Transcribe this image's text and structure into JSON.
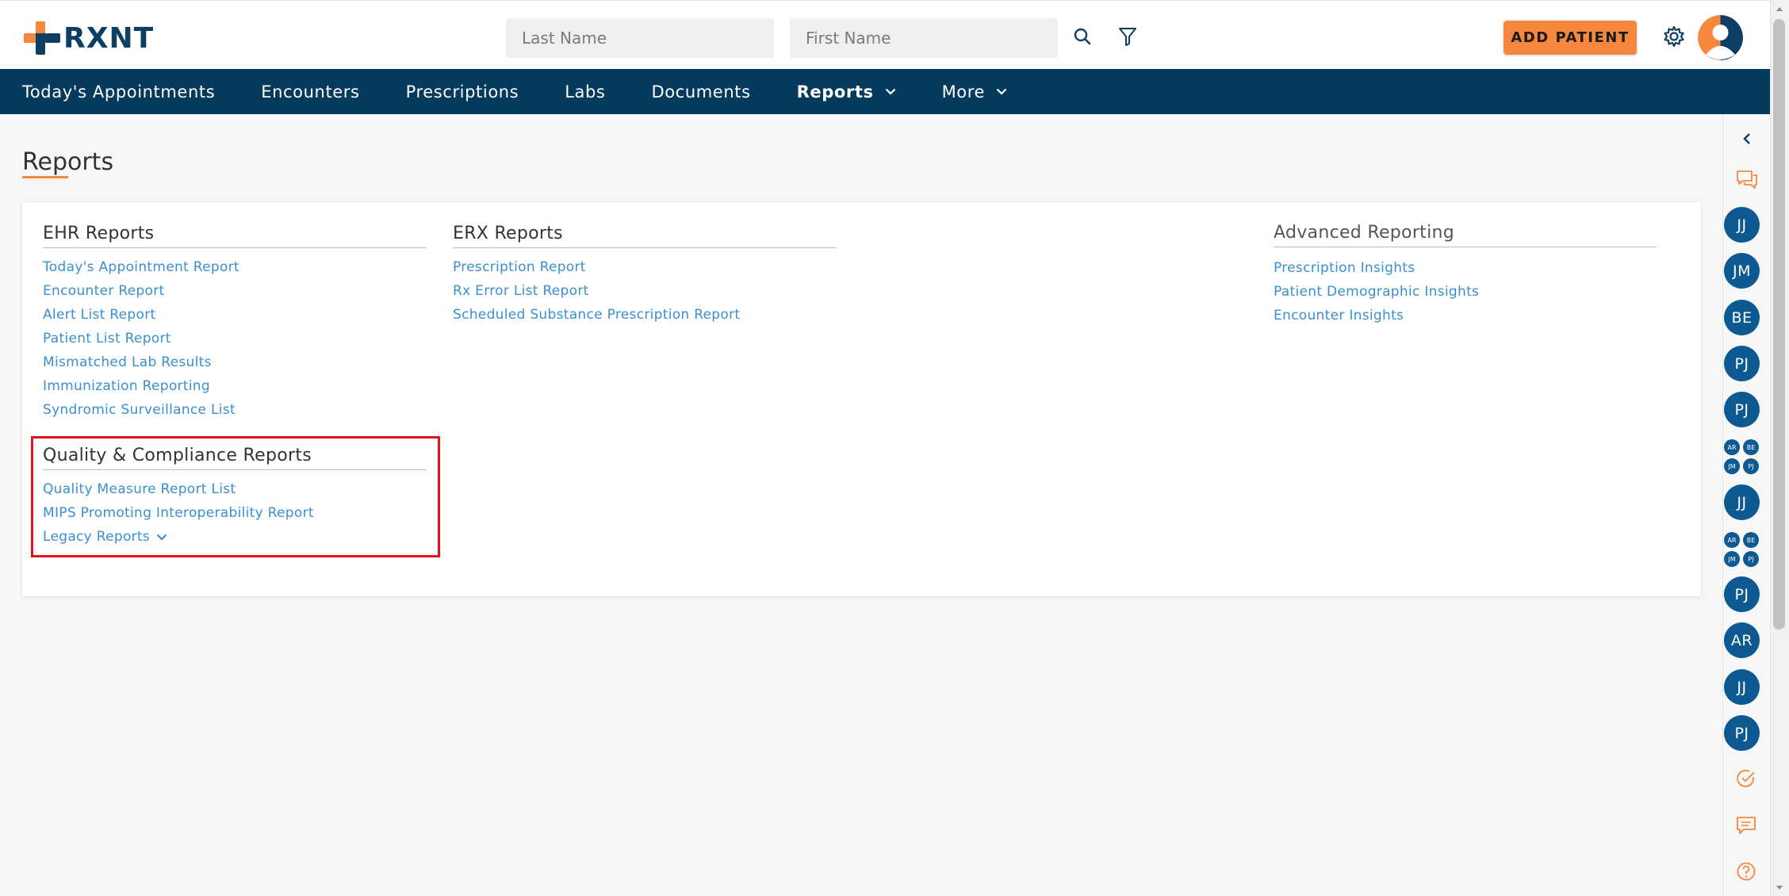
{
  "app": {
    "logo_text": "RXNT"
  },
  "header": {
    "last_name_placeholder": "Last Name",
    "first_name_placeholder": "First Name",
    "add_patient_label": "ADD PATIENT"
  },
  "nav": {
    "items": [
      {
        "label": "Today's Appointments"
      },
      {
        "label": "Encounters"
      },
      {
        "label": "Prescriptions"
      },
      {
        "label": "Labs"
      },
      {
        "label": "Documents"
      },
      {
        "label": "Reports"
      },
      {
        "label": "More"
      }
    ]
  },
  "page": {
    "title": "Reports"
  },
  "sections": {
    "ehr": {
      "title": "EHR Reports",
      "links": [
        "Today's Appointment Report",
        "Encounter Report",
        "Alert List Report",
        "Patient List Report",
        "Mismatched Lab Results",
        "Immunization Reporting",
        "Syndromic Surveillance List"
      ]
    },
    "erx": {
      "title": "ERX Reports",
      "links": [
        "Prescription Report",
        "Rx Error List Report",
        "Scheduled Substance Prescription Report"
      ]
    },
    "advanced": {
      "title": "Advanced Reporting",
      "links": [
        "Prescription Insights",
        "Patient Demographic Insights",
        "Encounter Insights"
      ]
    },
    "quality": {
      "title": "Quality & Compliance Reports",
      "links": [
        "Quality Measure Report List",
        "MIPS Promoting Interoperability Report"
      ],
      "legacy_label": "Legacy Reports"
    }
  },
  "rail": {
    "chips": [
      "JJ",
      "JM",
      "BE",
      "PJ",
      "PJ",
      "JJ",
      "PJ",
      "AR",
      "JJ",
      "PJ"
    ],
    "group": [
      "AR",
      "BE",
      "JM",
      "PJ"
    ]
  },
  "colors": {
    "nav_bg": "#053a5c",
    "accent_orange": "#f6873c",
    "link_blue": "#3a8fd1",
    "chip_blue": "#0d5a92",
    "highlight_red": "#e0141c"
  }
}
